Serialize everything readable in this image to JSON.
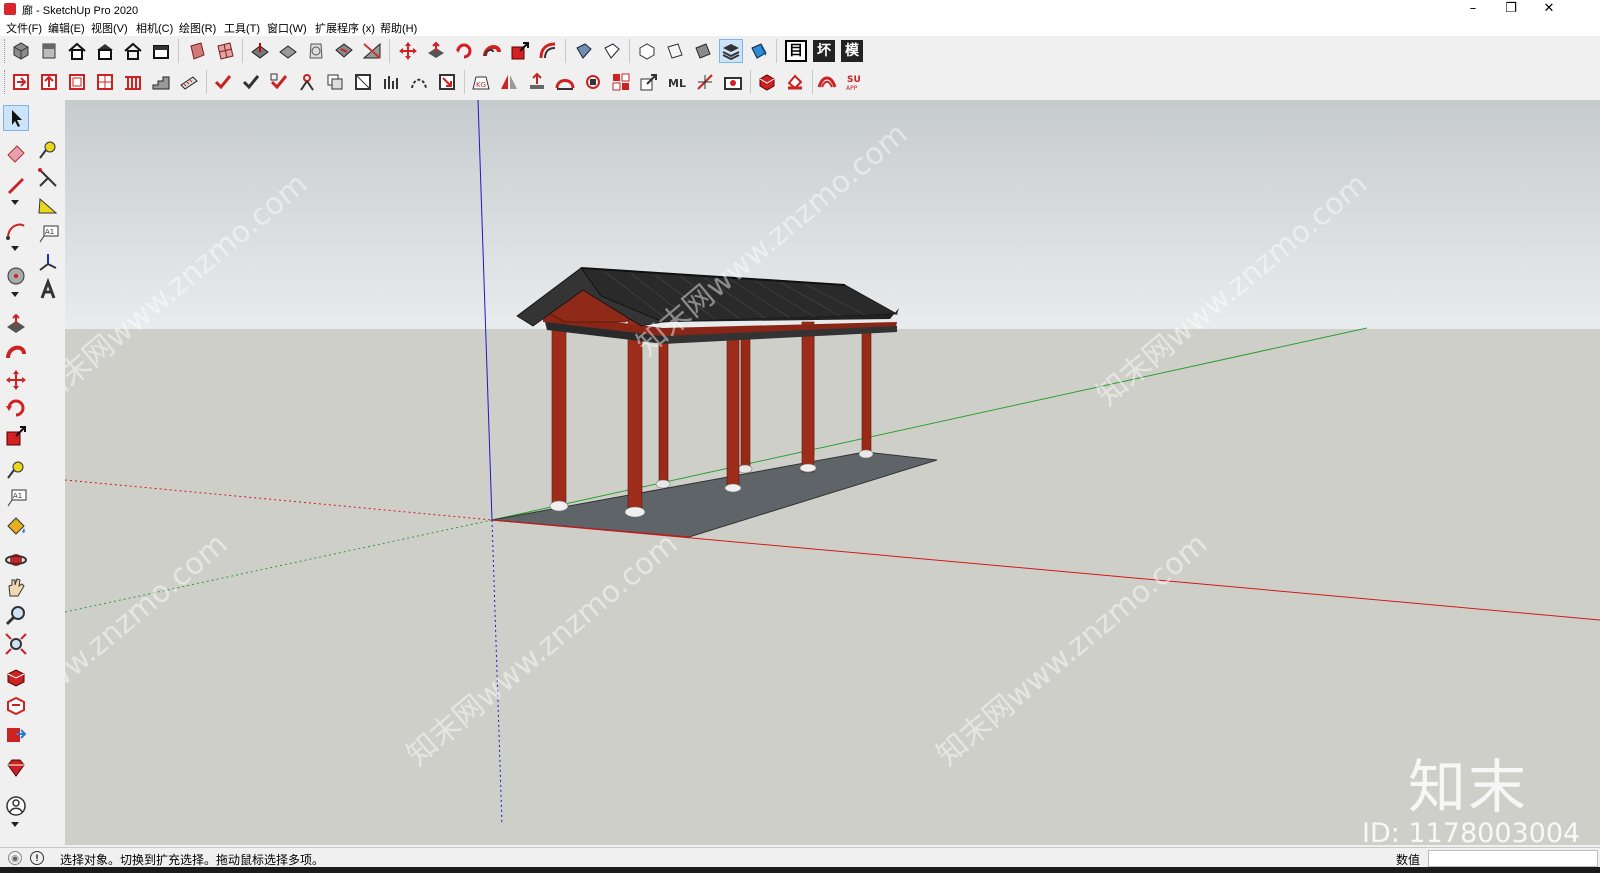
{
  "window": {
    "title": "廊 - SketchUp Pro 2020",
    "controls": {
      "minimize": "–",
      "maximize": "❐",
      "close": "✕"
    }
  },
  "menu": [
    "文件(F)",
    "编辑(E)",
    "视图(V)",
    "相机(C)",
    "绘图(R)",
    "工具(T)",
    "窗口(W)",
    "扩展程序 (x)",
    "帮助(H)"
  ],
  "toolbar_letters": [
    "目",
    "坏",
    "模"
  ],
  "status": {
    "hint": "选择对象。切换到扩充选择。拖动鼠标选择多项。",
    "measurements_label": "数值",
    "measurements_value": ""
  },
  "watermark": {
    "diagonal_text": "知末网www.znzmo.com",
    "brand": "知末",
    "id": "ID: 1178003004"
  },
  "colors": {
    "sky_top": "#c6cbcd",
    "sky_bottom": "#e9ecee",
    "ground": "#cfcfca",
    "columns": "#9a2a18",
    "roof": "#2a2a2a",
    "platform": "#5e6467",
    "axis_red": "#d11a1a",
    "axis_green": "#2ca02c",
    "axis_blue": "#1a1acc"
  }
}
